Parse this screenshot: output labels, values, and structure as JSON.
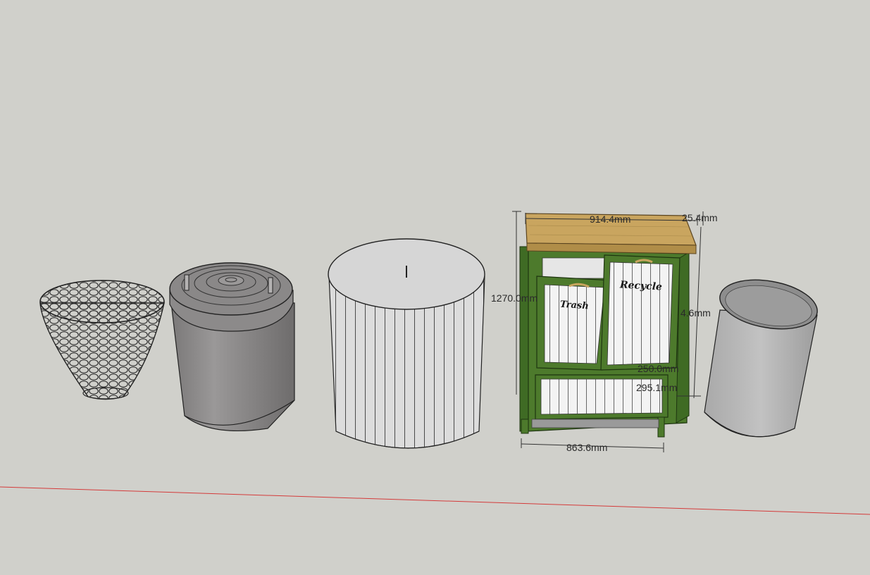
{
  "viewport": {
    "background": "#d0d0cb",
    "ground_axis_color": "#d43a3a"
  },
  "models": [
    {
      "name": "wire-mesh-basket",
      "color": "#555555"
    },
    {
      "name": "lidded-trash-can",
      "color": "#8a8888"
    },
    {
      "name": "ribbed-round-bin",
      "color": "#d8d8d8"
    },
    {
      "name": "trash-recycle-cabinet",
      "frame_color": "#4d7a2c",
      "top_color": "#c9a55f",
      "panel_color": "#f0f0f0"
    },
    {
      "name": "metal-cylinder-bin",
      "color": "#b4b4b4"
    }
  ],
  "cabinet_labels": {
    "left_door": "Trash",
    "right_door": "Recycle"
  },
  "dimensions": {
    "top_width": "914.4mm",
    "top_thickness": "25.4mm",
    "height": "1270.0mm",
    "right_side": "4.6mm",
    "door_gap": "250.0mm",
    "lower_panel": "295.1mm",
    "base_width": "863.6mm"
  }
}
